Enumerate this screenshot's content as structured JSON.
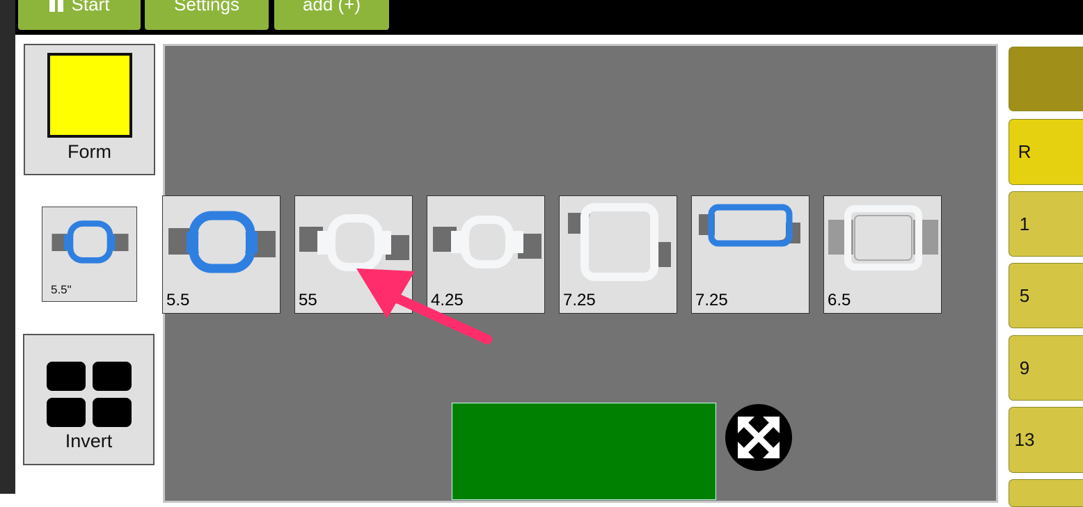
{
  "topbar": {
    "buttons": [
      {
        "label": "Start"
      },
      {
        "label": "Settings"
      },
      {
        "label": "add (+)"
      }
    ]
  },
  "tools": {
    "form": {
      "label": "Form",
      "swatch_color": "#ffff00"
    },
    "selected_hoop": {
      "caption": "5.5\""
    },
    "invert": {
      "label": "Invert"
    }
  },
  "hoops": [
    {
      "caption": "5.5",
      "style": "blue-rounded"
    },
    {
      "caption": "55",
      "style": "white-rounded"
    },
    {
      "caption": "4.25",
      "style": "white-rounded"
    },
    {
      "caption": "7.25",
      "style": "white-square"
    },
    {
      "caption": "7.25",
      "style": "blue-wide"
    },
    {
      "caption": "6.5",
      "style": "gray-rect"
    }
  ],
  "side_buttons": [
    {
      "label": "",
      "color": "#a08f18"
    },
    {
      "label": "R",
      "color": "#e5d10f"
    },
    {
      "label": "1",
      "color": "#d4c544"
    },
    {
      "label": "5",
      "color": "#d4c544"
    },
    {
      "label": "9",
      "color": "#d4c544"
    },
    {
      "label": "13",
      "color": "#d4c544"
    },
    {
      "label": "",
      "color": "#d4c544"
    }
  ],
  "colors": {
    "topbar_button": "#8db53c",
    "canvas": "#737373",
    "design_area": "#008000",
    "annotation_arrow": "#ff2d6b"
  }
}
